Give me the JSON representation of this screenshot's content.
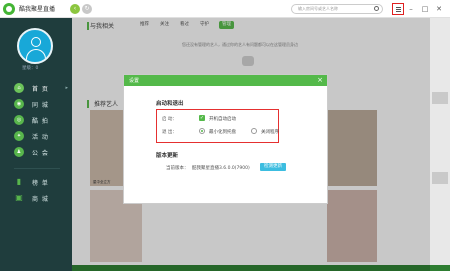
{
  "app": {
    "title": "酷我聚星直播"
  },
  "search": {
    "placeholder": "输入房间号或艺人名称"
  },
  "sidebar": {
    "level": "星级：0",
    "items": [
      {
        "label": "首 页",
        "icon": "home-icon",
        "glyph": "⌂"
      },
      {
        "label": "同 城",
        "icon": "location-icon",
        "glyph": "◉"
      },
      {
        "label": "酷 拍",
        "icon": "camera-icon",
        "glyph": "◎"
      },
      {
        "label": "活 动",
        "icon": "activity-icon",
        "glyph": "✦"
      },
      {
        "label": "公 会",
        "icon": "guild-icon",
        "glyph": "♟"
      },
      {
        "label": "榜 单",
        "icon": "chart-icon",
        "glyph": "▮"
      },
      {
        "label": "商 城",
        "icon": "shop-icon",
        "glyph": "▣"
      }
    ]
  },
  "main": {
    "section_title": "与我相关",
    "tabs": [
      "推荐",
      "关注",
      "看过",
      "守护",
      "管理"
    ],
    "empty_message": "您还没有管理的艺人，通过你的艺人有问题都可以在这管理员身边",
    "recommend_title": "推荐艺人",
    "card_label": "星中全立方"
  },
  "dialog": {
    "title": "设置",
    "close": "×",
    "autostart_section": "启动和退出",
    "boot_label": "启    动：",
    "boot_option": "开机自动启动",
    "close_label": "退    出：",
    "close_opt_min": "最小化到托盘",
    "close_opt_exit": "关闭程序",
    "version_section": "版本更新",
    "version_label": "当前版本：",
    "version_value": "酷我聚星直播3.6.0.0(7900)",
    "update_btn": "检测更新"
  },
  "colors": {
    "accent": "#54b94a",
    "sidebar": "#1f3d3d",
    "highlight": "#e53030"
  }
}
